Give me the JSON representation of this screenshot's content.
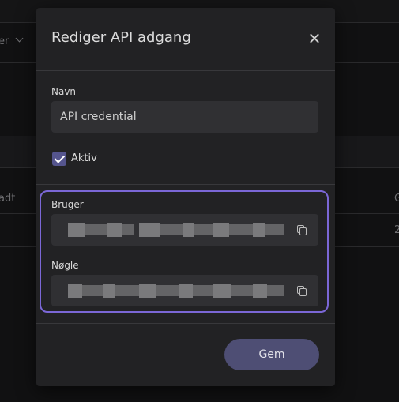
{
  "background": {
    "header_partial": "er",
    "column_partial_left": "adt",
    "column_partial_right": "G",
    "cell_partial_right": "2"
  },
  "modal": {
    "title": "Rediger API adgang",
    "close_icon": "close-icon",
    "name_label": "Navn",
    "name_value": "API credential",
    "active_label": "Aktiv",
    "active_checked": true,
    "user_label": "Bruger",
    "user_value_masked": true,
    "key_label": "Nøgle",
    "key_value_masked": true,
    "copy_icon": "copy-icon",
    "save_label": "Gem"
  },
  "colors": {
    "accent": "#7b67d6",
    "checkbox": "#55558e",
    "save_button": "#4e4e74",
    "modal_bg": "#222224",
    "input_bg": "#303033"
  }
}
